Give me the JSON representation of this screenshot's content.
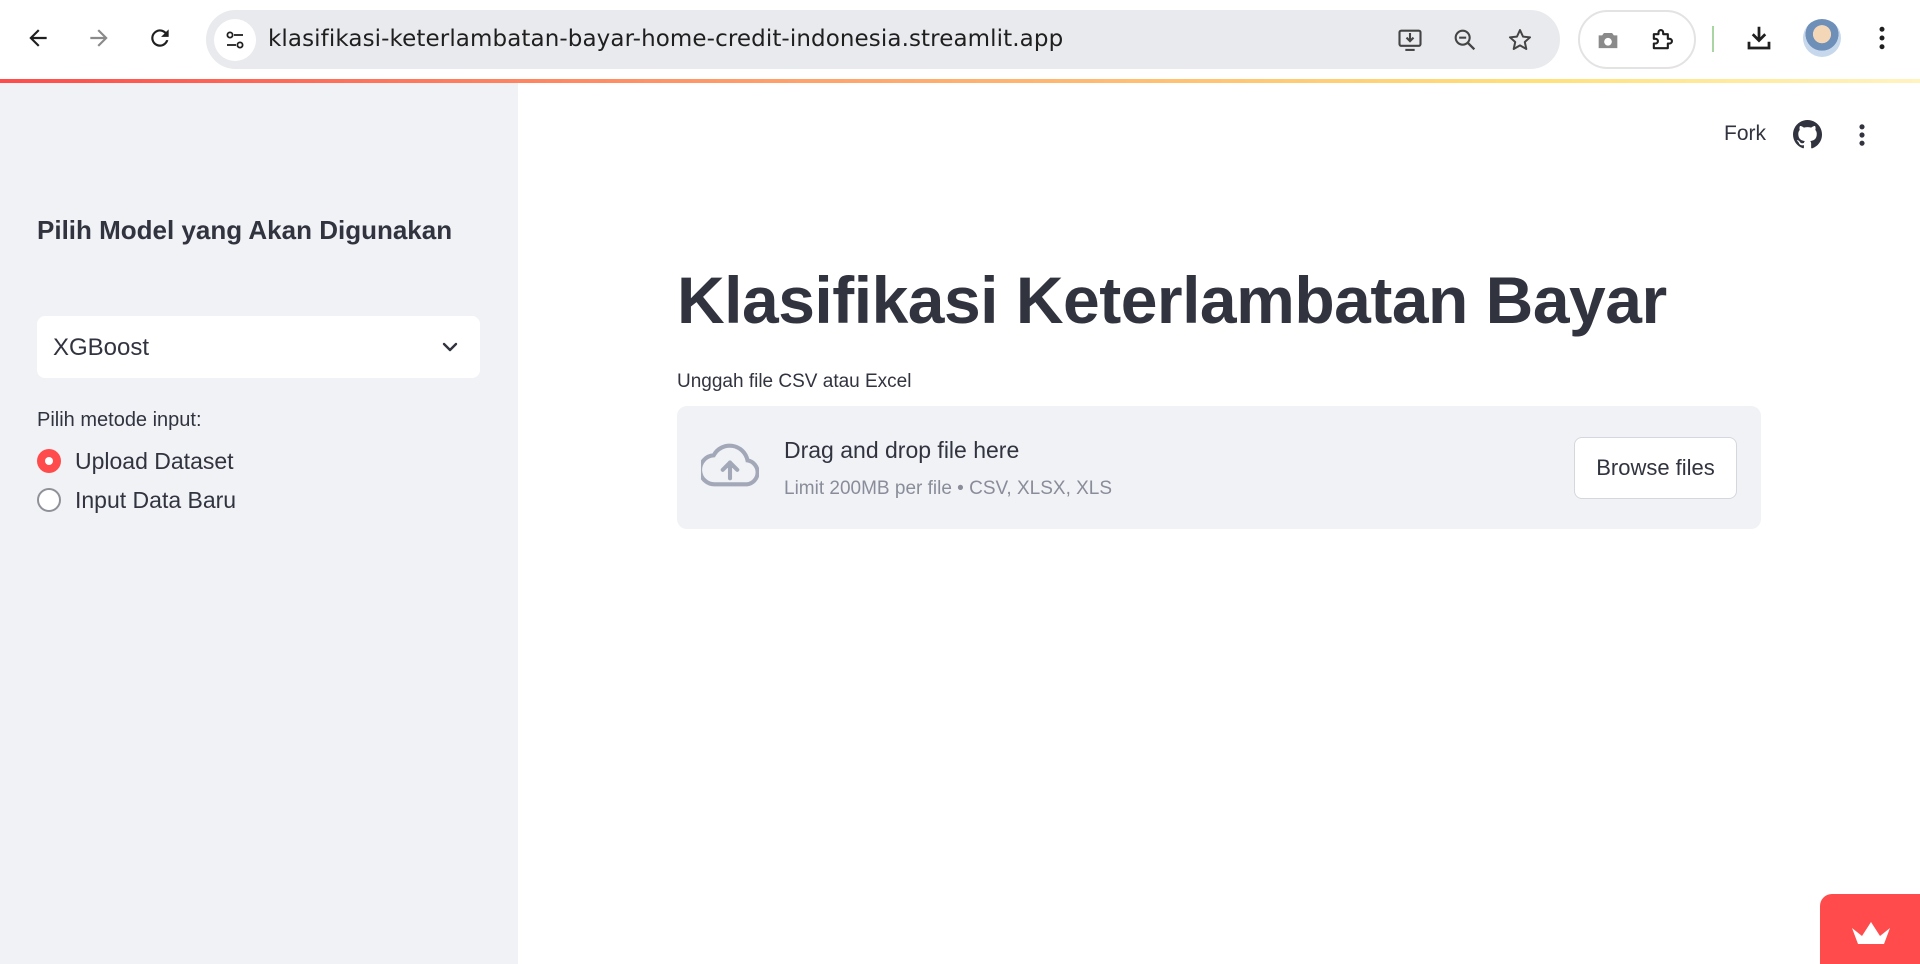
{
  "browser": {
    "url": "klasifikasi-keterlambatan-bayar-home-credit-indonesia.streamlit.app"
  },
  "sidebar": {
    "model_heading": "Pilih Model yang Akan Digunakan",
    "model_select_value": "XGBoost",
    "input_method_label": "Pilih metode input:",
    "radio_options": [
      "Upload Dataset",
      "Input Data Baru"
    ],
    "selected_option": "Upload Dataset"
  },
  "header": {
    "fork_label": "Fork"
  },
  "main": {
    "title": "Klasifikasi Keterlambatan Bayar",
    "uploader_label": "Unggah file CSV atau Excel",
    "dropzone_title": "Drag and drop file here",
    "dropzone_limit": "Limit 200MB per file • CSV, XLSX, XLS",
    "browse_button": "Browse files"
  },
  "colors": {
    "accent": "#ff4b4b",
    "sidebar_bg": "#f0f2f6",
    "text": "#31333f"
  }
}
